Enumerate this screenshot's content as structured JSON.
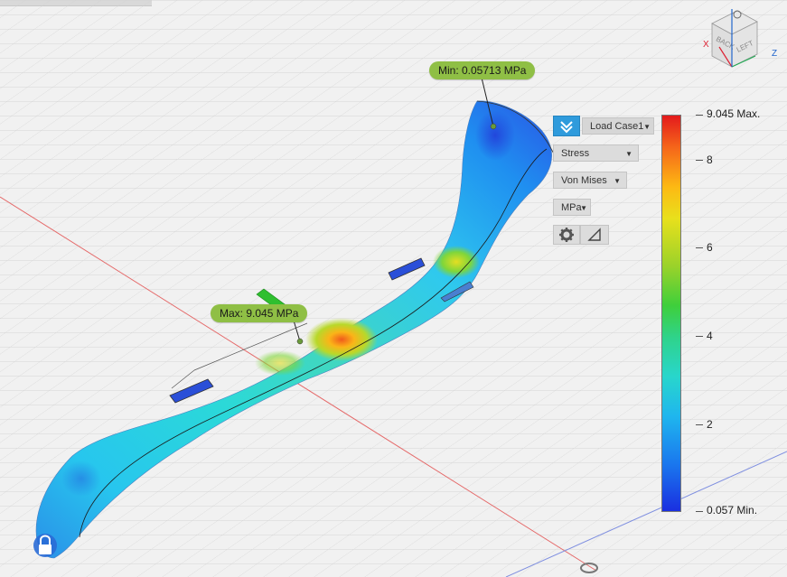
{
  "callouts": {
    "min": "Min: 0.05713 MPa",
    "max": "Max: 9.045 MPa"
  },
  "toolbar": {
    "load_case": "Load Case1",
    "result_type": "Stress",
    "criterion": "Von Mises",
    "unit": "MPa"
  },
  "legend": {
    "max_label": "9.045 Max.",
    "min_label": "0.057 Min.",
    "ticks": [
      "8",
      "6",
      "4",
      "2"
    ],
    "colors": {
      "high": "#e31a1c",
      "mid": "#3fcf3b",
      "low": "#1a2fe0"
    }
  },
  "viewcube": {
    "back": "BACK",
    "left": "LEFT",
    "axis_x": "X",
    "axis_z": "Z"
  },
  "icons": {
    "results_menu": "double-chevron-icon",
    "settings": "gear-icon",
    "deform": "triangle-icon",
    "lock": "lock-icon"
  }
}
